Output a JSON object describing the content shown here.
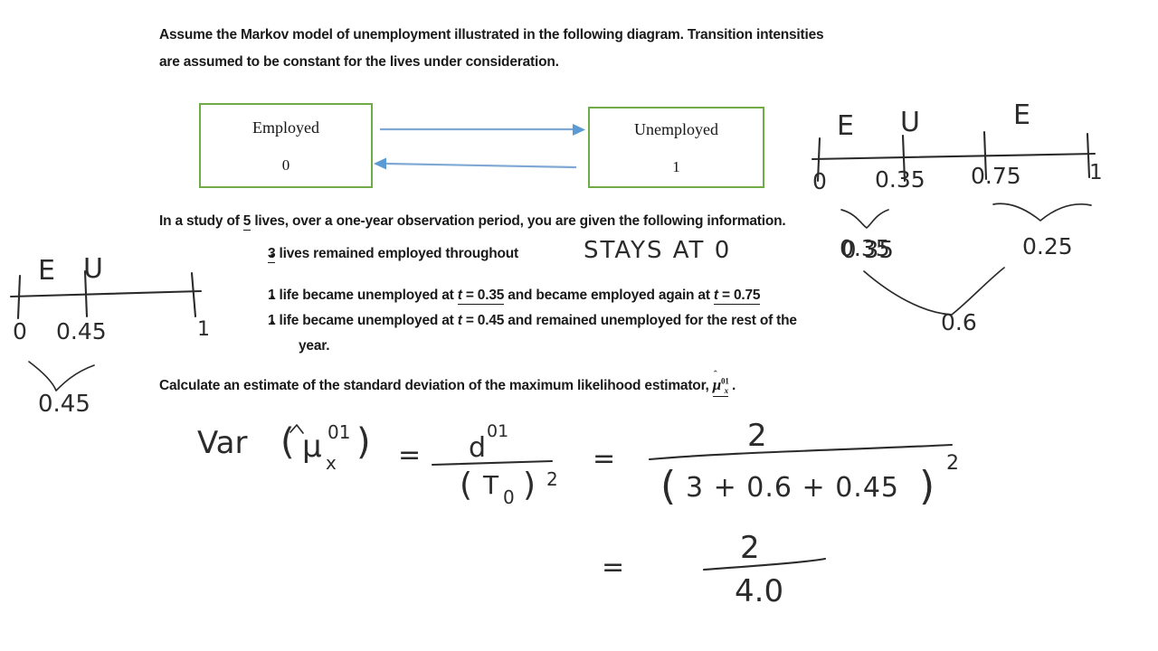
{
  "question": {
    "line1": "Assume the Markov model of unemployment illustrated in the following diagram. Transition intensities",
    "line2": "are assumed to be constant for the lives under consideration.",
    "study_prefix": "In a study of ",
    "study_count": "5",
    "study_suffix": " lives, over a one-year observation period, you are given the following information.",
    "bullets": [
      {
        "pre": "3",
        "post": " lives remained employed throughout"
      },
      {
        "a": "1 life became unemployed at ",
        "t1_var": "t",
        "t1_eq": " = 0.35",
        "b": " and became employed again at ",
        "t2_var": "t",
        "t2_eq": " = 0.75"
      },
      {
        "a": "1 life became unemployed at ",
        "t_var": "t",
        "t_eq": " = 0.45",
        "b": " and remained unemployed for the rest of the",
        "c": "year."
      }
    ],
    "calculate_prefix": "Calculate an estimate of the standard deviation of the maximum likelihood estimator, ",
    "estimator": {
      "hat": "ˆ",
      "mu": "μ",
      "sup": "01",
      "sub": "x"
    },
    "calculate_suffix": " ."
  },
  "diagram": {
    "employed": {
      "name": "Employed",
      "number": "0"
    },
    "unemployed": {
      "name": "Unemployed",
      "number": "1"
    },
    "border_color": "#6fab46",
    "arrow_color": "#7fa8d4"
  },
  "handwriting": {
    "timeline_right": {
      "states": [
        "E",
        "U",
        "E"
      ],
      "ticks": [
        "0",
        "0.35",
        "0.75",
        "1"
      ],
      "brace_values": [
        "0.35",
        "0.25"
      ],
      "sum_value": "0.6"
    },
    "timeline_left": {
      "states": [
        "E",
        "U"
      ],
      "ticks": [
        "0",
        "0.45",
        "1"
      ],
      "brace_value": "0.45"
    },
    "bullet_note": "STAYS AT 0",
    "bullet_note_value": "0 35",
    "equation": {
      "var_label": "Var",
      "open_paren": "(",
      "mu": "μ",
      "hat": "ˆ",
      "mu_sup": "01",
      "mu_sub": "x",
      "close_paren": ")",
      "equals1": "=",
      "num1": "d",
      "num1_sup": "01",
      "den1_open": "(",
      "den1": "T",
      "den1_sub": "0",
      "den1_close": ")",
      "den1_pow": "2",
      "equals2": "=",
      "num2": "2",
      "den2_open": "(",
      "den2": "3 + 0.6 + 0.45",
      "den2_close": ")",
      "den2_pow": "2",
      "equals3": "=",
      "num3": "2",
      "den3": "4.0"
    }
  }
}
